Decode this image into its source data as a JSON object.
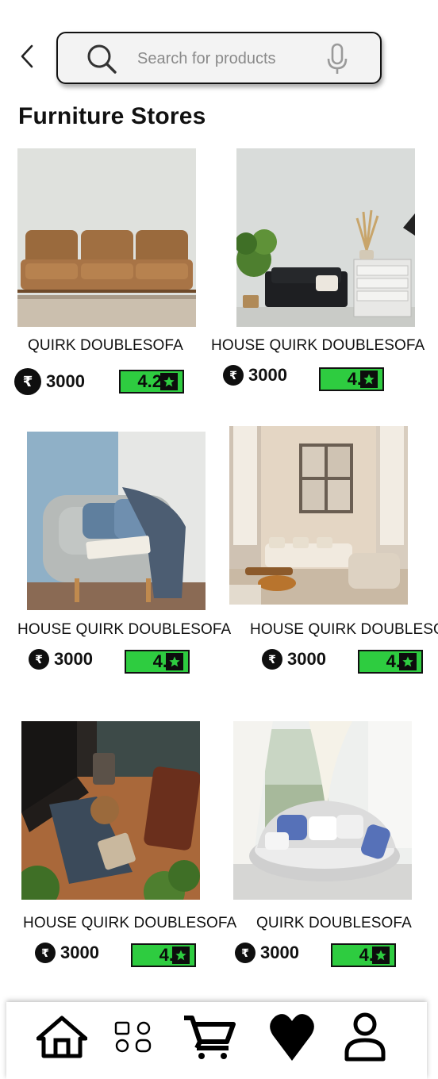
{
  "search": {
    "placeholder": "Search for products"
  },
  "page_title": "Furniture Stores",
  "currency_symbol": "₹",
  "products": [
    {
      "name": "QUIRK DOUBLESOFA",
      "price": "3000",
      "rating": "4.2"
    },
    {
      "name": "HOUSE  QUIRK DOUBLESOFA",
      "price": "3000",
      "rating": "4."
    },
    {
      "name": "HOUSE  QUIRK DOUBLESOFA",
      "price": "3000",
      "rating": "4."
    },
    {
      "name": "HOUSE  QUIRK DOUBLESOFA",
      "price": "3000",
      "rating": "4."
    },
    {
      "name": "HOUSE  QUIRK DOUBLESOFA",
      "price": "3000",
      "rating": "4."
    },
    {
      "name": "QUIRK DOUBLESOFA",
      "price": "3000",
      "rating": "4."
    }
  ],
  "bottom_nav": {
    "items": [
      {
        "icon": "home-icon"
      },
      {
        "icon": "categories-icon"
      },
      {
        "icon": "cart-icon"
      },
      {
        "icon": "heart-icon"
      },
      {
        "icon": "profile-icon"
      }
    ]
  },
  "colors": {
    "rating_badge": "#2ecc40",
    "text": "#111111",
    "search_bg": "#f3f3f3"
  }
}
